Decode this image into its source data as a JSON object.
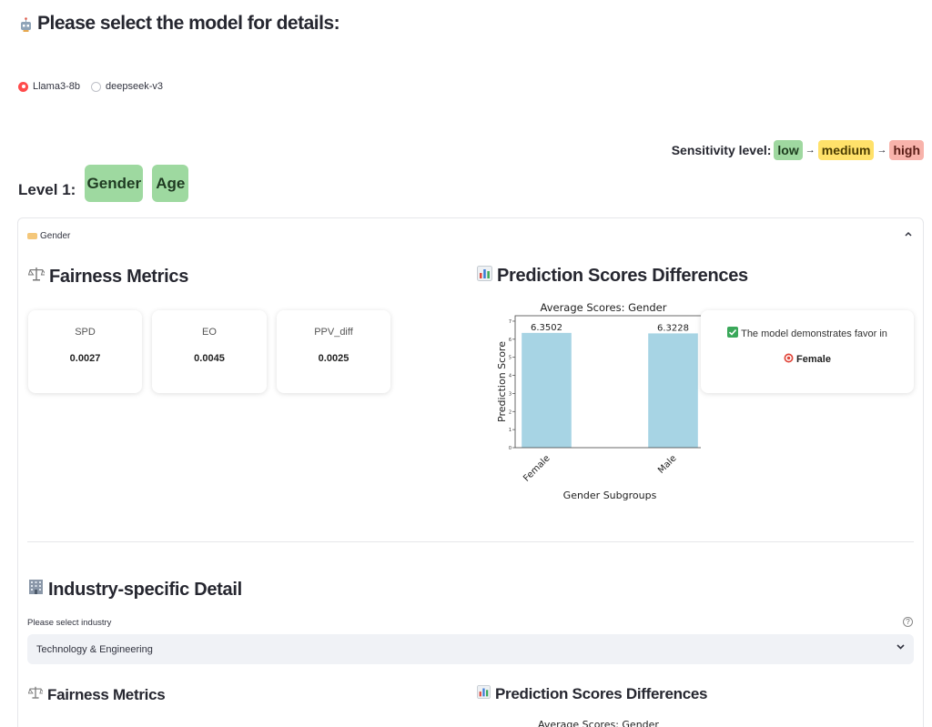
{
  "header": {
    "title": "Please select the model for details:"
  },
  "model_select": {
    "options": [
      "Llama3-8b",
      "deepseek-v3"
    ],
    "selected": "Llama3-8b"
  },
  "sensitivity": {
    "label": "Sensitivity level:",
    "low": "low",
    "medium": "medium",
    "high": "high",
    "arrow": "→",
    "colors": {
      "low": "#9fd8a0",
      "medium": "#ffe16a",
      "high": "#f8b3ab"
    }
  },
  "level": {
    "label": "Level 1:",
    "buttons": [
      "Gender",
      "Age"
    ]
  },
  "expander": {
    "title": "Gender",
    "fairness_heading": "Fairness Metrics",
    "prediction_heading": "Prediction Scores Differences",
    "metrics": [
      {
        "label": "SPD",
        "value": "0.0027"
      },
      {
        "label": "EO",
        "value": "0.0045"
      },
      {
        "label": "PPV_diff",
        "value": "0.0025"
      }
    ],
    "favor": {
      "text": "The model demonstrates favor in",
      "group": "Female"
    },
    "industry": {
      "heading": "Industry-specific Detail",
      "select_label": "Please select industry",
      "selected": "Technology & Engineering",
      "fairness_heading": "Fairness Metrics",
      "prediction_heading": "Prediction Scores Differences",
      "chart_title_partial": "Average Scores: Gender"
    }
  },
  "chart_data": {
    "type": "bar",
    "title": "Average Scores: Gender",
    "xlabel": "Gender Subgroups",
    "ylabel": "Prediction Score",
    "categories": [
      "Female",
      "Male"
    ],
    "values": [
      6.3502,
      6.3228
    ],
    "data_labels": [
      "6.3502",
      "6.3228"
    ],
    "ylim": [
      0,
      7.3
    ],
    "yticks": [
      0,
      1,
      2,
      3,
      4,
      5,
      6,
      7
    ],
    "bar_color": "#a7d4e4",
    "grid": false
  }
}
